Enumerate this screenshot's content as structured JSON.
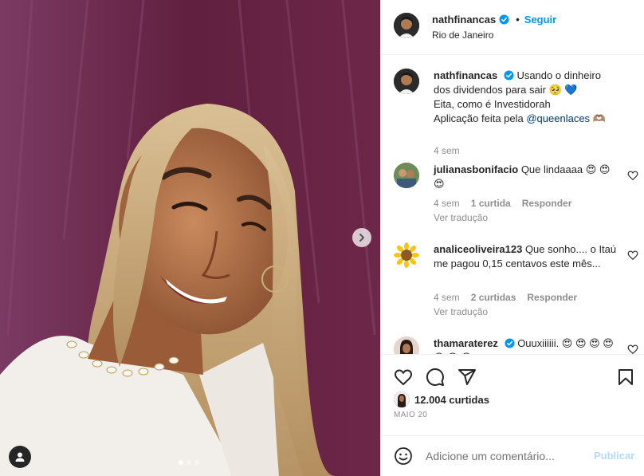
{
  "header": {
    "username": "nathfinancas",
    "follow_label": "Seguir",
    "separator": "•",
    "location": "Rio de Janeiro"
  },
  "caption": {
    "username": "nathfinancas",
    "line1": "Usando o dinheiro dos dividendos para sair 🥺 💙",
    "line2": "Eita, como é Investidorah",
    "line3_prefix": "Aplicação feita pela ",
    "mention": "@queenlaces",
    "line3_suffix": " 🫶🏽",
    "time": "4 sem"
  },
  "comments": [
    {
      "username": "julianasbonifacio",
      "text": "Que lindaaaa 😍 😍 😍",
      "time": "4 sem",
      "likes": "1 curtida",
      "reply": "Responder",
      "translate": "Ver tradução"
    },
    {
      "username": "analiceoliveira123",
      "text": "Que sonho.... o Itaú me pagou 0,15 centavos este mês...",
      "time": "4 sem",
      "likes": "2 curtidas",
      "reply": "Responder",
      "translate": "Ver tradução"
    },
    {
      "username": "thamaraterez",
      "text": "Ouuxiiiiii. 😍 😍 😍 😍 😍 😍 😍"
    }
  ],
  "post": {
    "likes": "12.004 curtidas",
    "date": "MAIO 20"
  },
  "comment_box": {
    "placeholder": "Adicione um comentário...",
    "post_label": "Publicar"
  },
  "icons": {
    "like": "heart-icon",
    "comment": "comment-icon",
    "share": "share-icon",
    "save": "bookmark-icon",
    "emoji": "emoji-icon",
    "next": "chevron-right-icon",
    "tag": "user-tag-icon",
    "verified": "verified-badge-icon"
  },
  "colors": {
    "link": "#0095f6",
    "mention": "#00376b",
    "muted": "#8e8e8e",
    "post_disabled": "#b3dbff",
    "verified": "#0095f6"
  },
  "carousel": {
    "slides": 3,
    "active_index": 0
  }
}
